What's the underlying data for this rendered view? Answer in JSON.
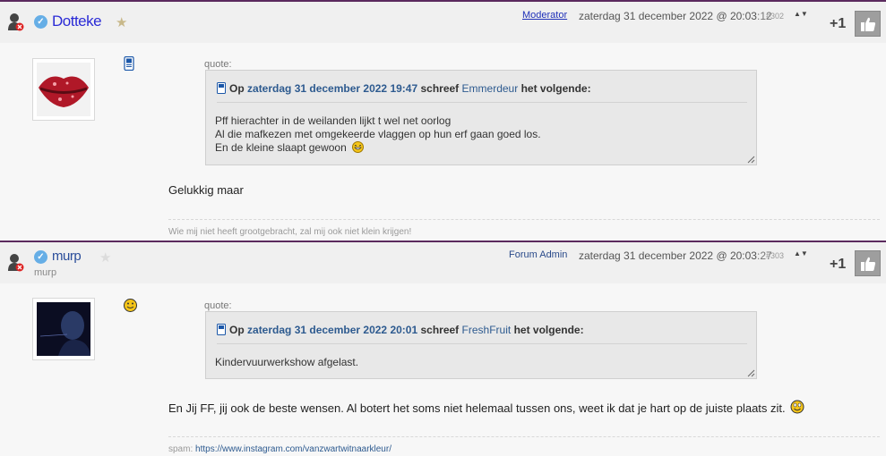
{
  "posts": [
    {
      "username": "Dotteke",
      "role": "Moderator",
      "date": "zaterdag 31 december 2022 @ 20:03",
      "seconds": ":12",
      "post_number": "#302",
      "plus_one": "+1",
      "quote_label": "quote:",
      "quote_head": {
        "op": "Op",
        "date": "zaterdag 31 december 2022 19:47",
        "schreef": "schreef",
        "author": "Emmerdeur",
        "rest": "het volgende:"
      },
      "quote_lines": [
        "Pff hierachter in de weilanden lijkt t wel net oorlog",
        "Al die mafkezen met omgekeerde vlaggen op hun erf gaan goed los.",
        "En de kleine slaapt gewoon"
      ],
      "message": "Gelukkig maar",
      "signature": "Wie mij niet heeft grootgebracht, zal mij ook niet klein krijgen!"
    },
    {
      "username": "murp",
      "subname": "murp",
      "role": "Forum Admin",
      "date": "zaterdag 31 december 2022 @ 20:03",
      "seconds": ":27",
      "post_number": "#303",
      "plus_one": "+1",
      "quote_label": "quote:",
      "quote_head": {
        "op": "Op",
        "date": "zaterdag 31 december 2022 20:01",
        "schreef": "schreef",
        "author": "FreshFruit",
        "rest": "het volgende:"
      },
      "quote_lines": [
        "Kindervuurwerkshow afgelast."
      ],
      "message": "En Jij FF, jij ook de beste wensen. Al botert het soms niet helemaal tussen ons, weet ik dat je hart op de juiste plaats zit.",
      "signature_prefix": "spam:",
      "signature_link": "https://www.instagram.com/vanzwartwitnaarkleur/"
    }
  ],
  "colors": {
    "accent_border": "#5b2a5e",
    "link": "#2d5a8f",
    "username": "#2b2bd6"
  },
  "icons": [
    "user-icon",
    "verified-icon",
    "star-icon",
    "thumbs-up-icon",
    "mobile-phone-icon",
    "smiley-icon",
    "resize-icon"
  ]
}
